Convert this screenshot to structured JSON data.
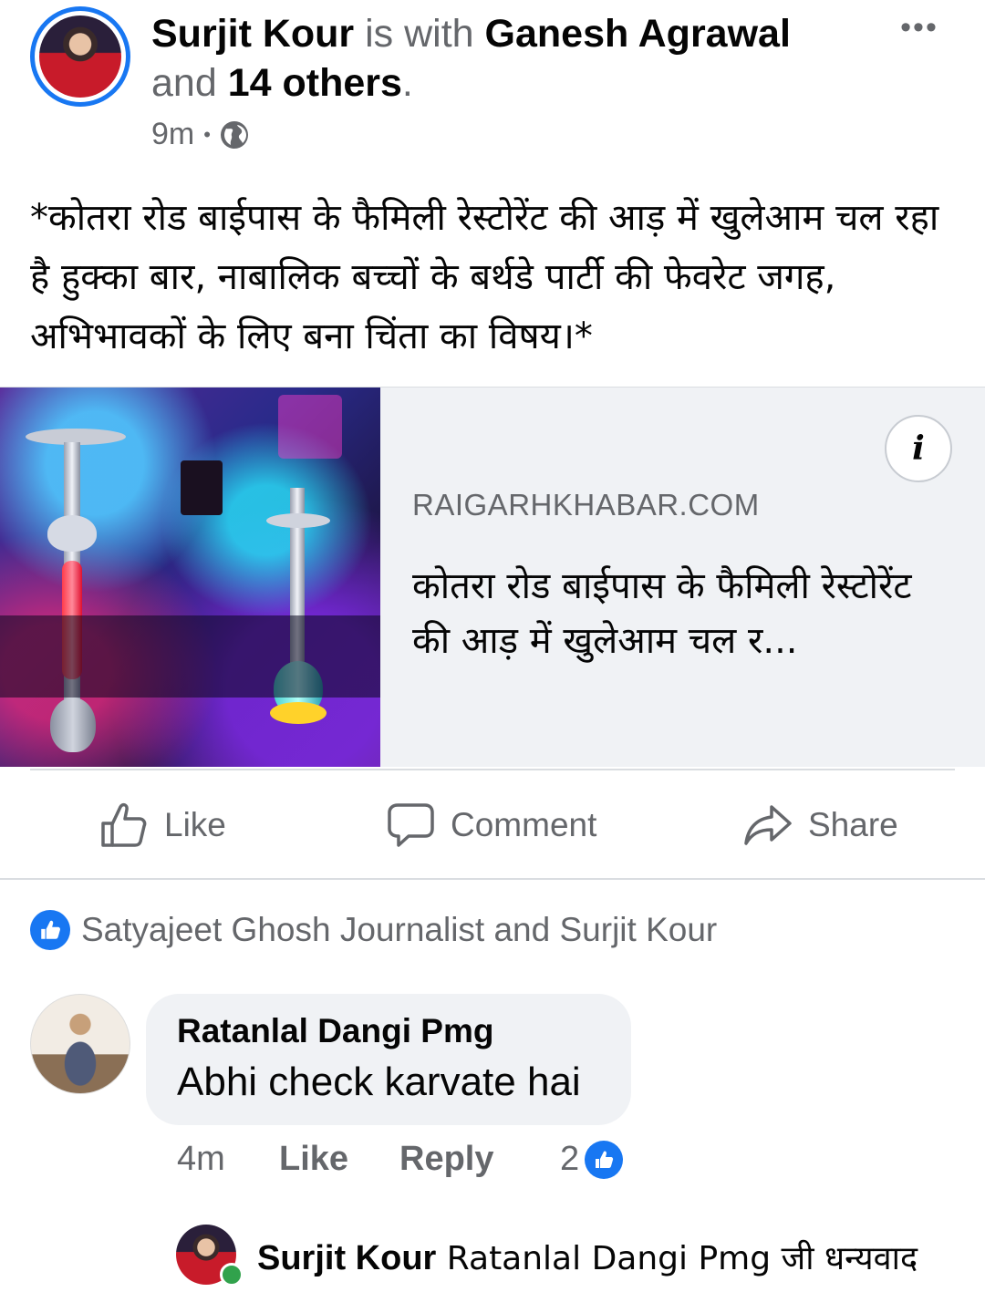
{
  "post": {
    "author": "Surjit Kour",
    "with_text": "is with",
    "tagged": "Ganesh Agrawal",
    "and_text": "and",
    "others": "14 others",
    "period": ".",
    "time": "9m",
    "separator": "•",
    "privacy_icon": "globe-icon",
    "text": "*कोतरा रोड बाईपास के फैमिली रेस्टोरेंट की आड़ में खुलेआम चल रहा है हुक्का बार, नाबालिक बच्चों के बर्थडे पार्टी की फेवरेट जगह, अभिभावकों के लिए बना चिंता का विषय।*",
    "more": "•••"
  },
  "link": {
    "info": "i",
    "domain": "RAIGARHKHABAR.COM",
    "title": "कोतरा रोड बाईपास के फैमिली रेस्टोरेंट की आड़ में खुलेआम चल र..."
  },
  "actions": {
    "like": "Like",
    "comment": "Comment",
    "share": "Share"
  },
  "reactions": {
    "text": "Satyajeet Ghosh Journalist and Surjit Kour"
  },
  "comment": {
    "name": "Ratanlal Dangi Pmg",
    "text": "Abhi check karvate hai",
    "time": "4m",
    "like": "Like",
    "reply": "Reply",
    "count": "2"
  },
  "reply": {
    "name": "Surjit Kour",
    "text": "Ratanlal Dangi Pmg जी धन्यवाद"
  },
  "colors": {
    "accent": "#1877f2",
    "secondary_text": "#65676b",
    "online": "#31a24c"
  }
}
